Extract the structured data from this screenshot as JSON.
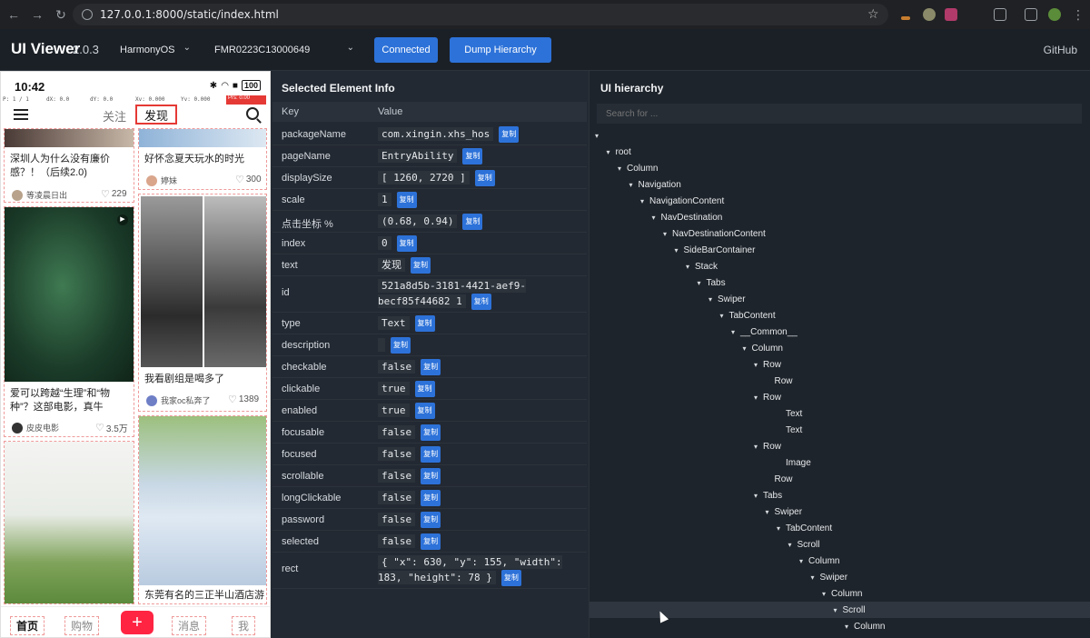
{
  "browser": {
    "url": "127.0.0.1:8000/static/index.html"
  },
  "header": {
    "title": "UI Viewer",
    "version": "2.0.3",
    "platform": "HarmonyOS",
    "device": "FMR0223C13000649",
    "connect_label": "Connected",
    "dump_label": "Dump Hierarchy",
    "github_label": "GitHub"
  },
  "phone": {
    "time": "10:42",
    "battery": "100",
    "debug": [
      "P: 1 / 1",
      "dX: 0.0",
      "dY: 0.0",
      "Xv: 0.000",
      "Yv: 0.000",
      "Prs: 0.00"
    ],
    "tab_follow": "关注",
    "tab_discover": "发现",
    "cards": [
      {
        "title": "深圳人为什么没有廉价感？！（后续2.0)",
        "author": "等凌晨日出",
        "likes": "229"
      },
      {
        "title": "好怀念夏天玩水的时光",
        "author": "婷妹",
        "likes": "300"
      },
      {
        "title": "爱可以跨越“生理”和“物种”？这部电影，真牛",
        "author": "皮皮电影",
        "likes": "3.5万"
      },
      {
        "title": "我看剧组是喝多了",
        "author": "我家oc私奔了",
        "likes": "1389"
      },
      {
        "title": "东莞有名的三正半山酒店游",
        "author": "",
        "likes": ""
      }
    ],
    "bottom": [
      "首页",
      "购物",
      "消息",
      "我"
    ],
    "plus": "+"
  },
  "info": {
    "title": "Selected Element Info",
    "key_header": "Key",
    "value_header": "Value",
    "copy_label": "复制",
    "rows": [
      {
        "key": "packageName",
        "value": "com.xingin.xhs_hos"
      },
      {
        "key": "pageName",
        "value": "EntryAbility"
      },
      {
        "key": "displaySize",
        "value": "[ 1260, 2720 ]"
      },
      {
        "key": "scale",
        "value": "1"
      },
      {
        "key": "点击坐标 %",
        "value": "(0.68, 0.94)"
      },
      {
        "key": "index",
        "value": "0"
      },
      {
        "key": "text",
        "value": "发现"
      },
      {
        "key": "id",
        "value": "521a8d5b-3181-4421-aef9-becf85f44682 1"
      },
      {
        "key": "type",
        "value": "Text"
      },
      {
        "key": "description",
        "value": ""
      },
      {
        "key": "checkable",
        "value": "false"
      },
      {
        "key": "clickable",
        "value": "true"
      },
      {
        "key": "enabled",
        "value": "true"
      },
      {
        "key": "focusable",
        "value": "false"
      },
      {
        "key": "focused",
        "value": "false"
      },
      {
        "key": "scrollable",
        "value": "false"
      },
      {
        "key": "longClickable",
        "value": "false"
      },
      {
        "key": "password",
        "value": "false"
      },
      {
        "key": "selected",
        "value": "false"
      },
      {
        "key": "rect",
        "value": "{ \"x\": 630, \"y\": 155, \"width\": 183, \"height\": 78 }"
      }
    ]
  },
  "hierarchy": {
    "title": "UI hierarchy",
    "search_placeholder": "Search for ...",
    "nodes": [
      {
        "label": "",
        "depth": 0,
        "caret": true
      },
      {
        "label": "root",
        "depth": 1,
        "caret": true
      },
      {
        "label": "Column",
        "depth": 2,
        "caret": true
      },
      {
        "label": "Navigation",
        "depth": 3,
        "caret": true
      },
      {
        "label": "NavigationContent",
        "depth": 4,
        "caret": true
      },
      {
        "label": "NavDestination",
        "depth": 5,
        "caret": true
      },
      {
        "label": "NavDestinationContent",
        "depth": 6,
        "caret": true
      },
      {
        "label": "SideBarContainer",
        "depth": 7,
        "caret": true
      },
      {
        "label": "Stack",
        "depth": 8,
        "caret": true
      },
      {
        "label": "Tabs",
        "depth": 9,
        "caret": true
      },
      {
        "label": "Swiper",
        "depth": 10,
        "caret": true
      },
      {
        "label": "TabContent",
        "depth": 11,
        "caret": true
      },
      {
        "label": "__Common__",
        "depth": 12,
        "caret": true
      },
      {
        "label": "Column",
        "depth": 13,
        "caret": true
      },
      {
        "label": "Row",
        "depth": 14,
        "caret": true
      },
      {
        "label": "Row",
        "depth": 15,
        "caret": false
      },
      {
        "label": "Row",
        "depth": 14,
        "caret": true
      },
      {
        "label": "Text",
        "depth": 16,
        "caret": false
      },
      {
        "label": "Text",
        "depth": 16,
        "caret": false
      },
      {
        "label": "Row",
        "depth": 14,
        "caret": true
      },
      {
        "label": "Image",
        "depth": 16,
        "caret": false
      },
      {
        "label": "Row",
        "depth": 15,
        "caret": false
      },
      {
        "label": "Tabs",
        "depth": 14,
        "caret": true
      },
      {
        "label": "Swiper",
        "depth": 15,
        "caret": true
      },
      {
        "label": "TabContent",
        "depth": 16,
        "caret": true
      },
      {
        "label": "Scroll",
        "depth": 17,
        "caret": true
      },
      {
        "label": "Column",
        "depth": 18,
        "caret": true
      },
      {
        "label": "Swiper",
        "depth": 19,
        "caret": true
      },
      {
        "label": "Column",
        "depth": 20,
        "caret": true
      },
      {
        "label": "Scroll",
        "depth": 21,
        "caret": true,
        "selected": true
      },
      {
        "label": "Column",
        "depth": 22,
        "caret": true
      }
    ]
  }
}
